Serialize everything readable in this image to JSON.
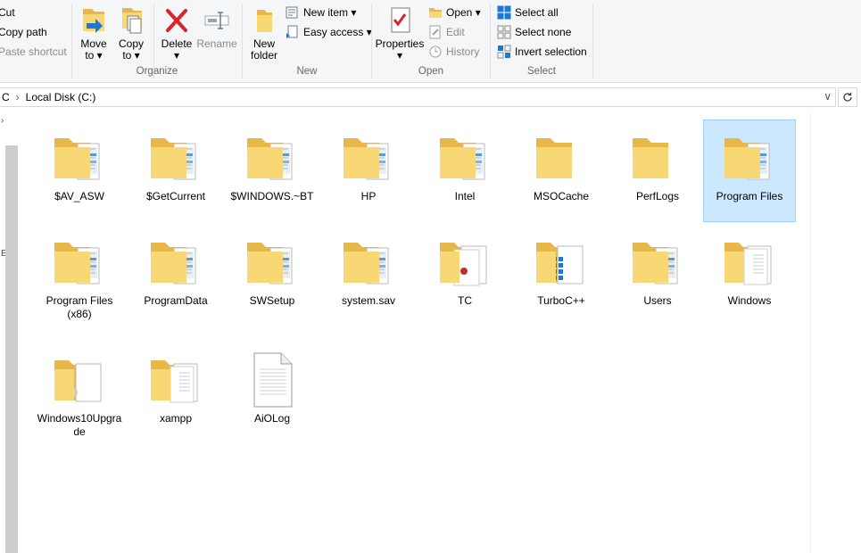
{
  "clipboard": {
    "cut": "Cut",
    "copy_path": "Copy path",
    "paste_shortcut": "Paste shortcut"
  },
  "organize": {
    "label": "Organize",
    "move_to": [
      "Move",
      "to ▾"
    ],
    "copy_to": [
      "Copy",
      "to ▾"
    ],
    "delete": "Delete",
    "delete_arrow": "▾",
    "rename": "Rename"
  },
  "new_group": {
    "label": "New",
    "new_folder": [
      "New",
      "folder"
    ],
    "new_item": "New item ▾",
    "easy_access": "Easy access ▾"
  },
  "open_group": {
    "label": "Open",
    "properties": "Properties",
    "properties_arrow": "▾",
    "open": "Open ▾",
    "edit": "Edit",
    "history": "History"
  },
  "select_group": {
    "label": "Select",
    "select_all": "Select all",
    "select_none": "Select none",
    "invert_selection": "Invert selection"
  },
  "address": {
    "prefix": "C",
    "separator": "›",
    "location": "Local Disk (C:)",
    "dropdown": "∨",
    "refresh_icon": "refresh-icon"
  },
  "files": [
    {
      "name": "$AV_ASW",
      "kind": "folder-docs"
    },
    {
      "name": "$GetCurrent",
      "kind": "folder-docs"
    },
    {
      "name": "$WINDOWS.~BT",
      "kind": "folder-docs"
    },
    {
      "name": "HP",
      "kind": "folder-docs"
    },
    {
      "name": "Intel",
      "kind": "folder-docs"
    },
    {
      "name": "MSOCache",
      "kind": "folder-empty"
    },
    {
      "name": "PerfLogs",
      "kind": "folder-empty"
    },
    {
      "name": "Program Files",
      "kind": "folder-docs",
      "selected": true
    },
    {
      "name": "Program Files (x86)",
      "kind": "folder-docs"
    },
    {
      "name": "ProgramData",
      "kind": "folder-docs"
    },
    {
      "name": "SWSetup",
      "kind": "folder-docs"
    },
    {
      "name": "system.sav",
      "kind": "folder-docs"
    },
    {
      "name": "TC",
      "kind": "folder-tc"
    },
    {
      "name": "TurboC++",
      "kind": "folder-turbo"
    },
    {
      "name": "Users",
      "kind": "folder-docs"
    },
    {
      "name": "Windows",
      "kind": "folder-pages"
    },
    {
      "name": "Windows10Upgrade",
      "kind": "folder-upgrade"
    },
    {
      "name": "xampp",
      "kind": "folder-pages"
    },
    {
      "name": "AiOLog",
      "kind": "file"
    }
  ],
  "colors": {
    "selection": "#cce8ff",
    "selection_border": "#99d1ff",
    "folder": "#f8d775",
    "folder_back": "#e8b74a",
    "delete_red": "#d9232d",
    "select_blue": "#1e78d6"
  }
}
